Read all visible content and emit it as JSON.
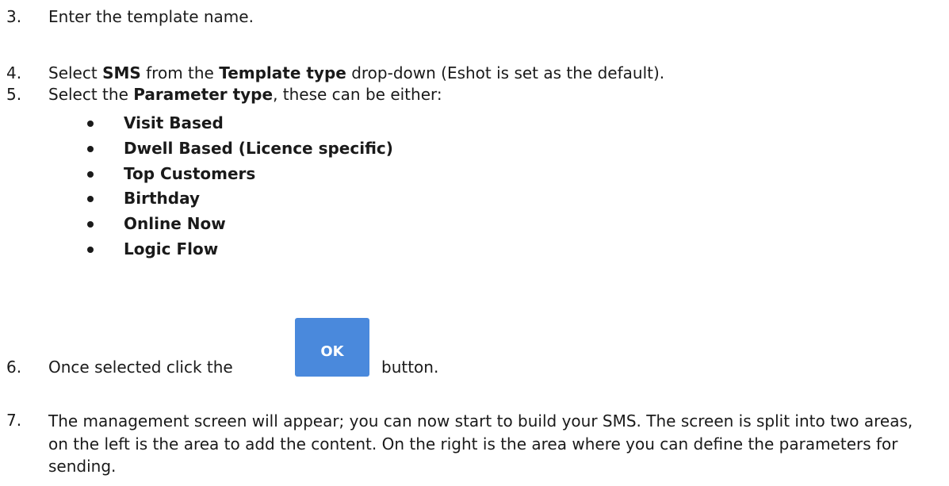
{
  "steps": {
    "s3": {
      "num": "3.",
      "text": "Enter the template name."
    },
    "s4": {
      "num": "4.",
      "pre": "Select ",
      "b1": "SMS",
      "mid": " from the ",
      "b2": "Template type",
      "post": " drop-down (Eshot is set as the default)."
    },
    "s5": {
      "num": "5.",
      "pre": "Select the ",
      "b1": "Parameter type",
      "post": ", these can be either:"
    },
    "s6": {
      "num": "6.",
      "pre": "Once selected click the",
      "post": "button."
    },
    "s7": {
      "num": "7.",
      "text": "The management screen will appear; you can now start to build your SMS. The screen is split into two areas, on the left is the area to add the content. On the right is the area where you can define the parameters for sending."
    }
  },
  "parameter_types": [
    "Visit Based",
    "Dwell Based (Licence specific)",
    "Top Customers",
    "Birthday",
    "Online Now",
    "Logic Flow"
  ],
  "ok_button": {
    "label": "OK",
    "color": "#4a89dc"
  }
}
